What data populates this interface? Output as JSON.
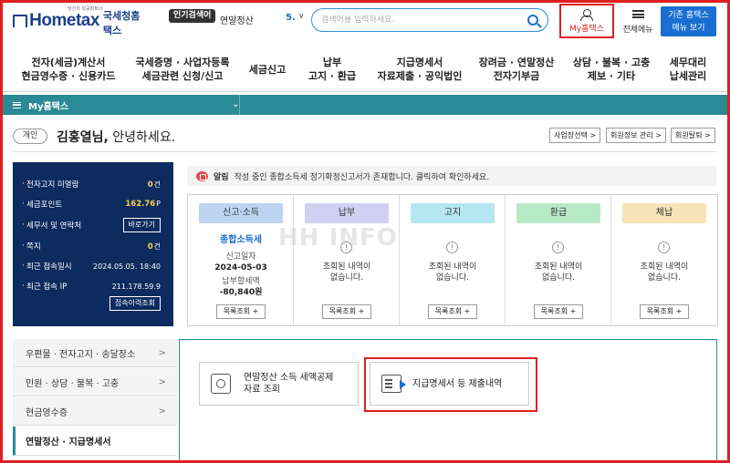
{
  "header": {
    "logo_text": "Hometax",
    "logo_sub": "국세청홈택스",
    "logo_tagline": "당신의 성공파트너",
    "popular_label": "인기검색어",
    "popular_value": "연말정산",
    "popular_rank": "5.",
    "search_placeholder": "검색어를 입력하세요.",
    "myhometax_label": "My홈택스",
    "allmenu_label": "전체메뉴",
    "oldhome_label": "기존 홈택스\n메뉴 보기"
  },
  "gnb": [
    {
      "label": "전자(세금)계산서\n현금영수증 · 신용카드"
    },
    {
      "label": "국세증명 · 사업자등록\n세금관련 신청/신고"
    },
    {
      "label": "세금신고"
    },
    {
      "label": "납부\n고지 · 환급"
    },
    {
      "label": "지급명세서\n자료제출 · 공익법인"
    },
    {
      "label": "장려금 · 연말정산\n전자기부금"
    },
    {
      "label": "상담 · 불복 · 고충\n제보 · 기타"
    },
    {
      "label": "세무대리\n납세관리"
    }
  ],
  "mybar": {
    "label": "My홈택스"
  },
  "user": {
    "badge": "개인",
    "name": "김홍열님,",
    "greeting": " 안녕하세요.",
    "btn_business": "사업장선택 >",
    "btn_member": "회원정보 관리 >",
    "btn_withdraw": "회원탈퇴 >"
  },
  "summary": {
    "rows": [
      {
        "label": "전자고지 미열람",
        "value": "0",
        "unit": "건"
      },
      {
        "label": "세금포인트",
        "value": "162.76",
        "unit": "P"
      },
      {
        "label": "세무서 및 연락처",
        "button": "바로가기"
      },
      {
        "label": "쪽지",
        "value": "0",
        "unit": "건"
      },
      {
        "label": "최근 접속일시",
        "value": "2024.05.05.  18:40"
      },
      {
        "label": "최근 접속 IP",
        "value": "211.178.59.9"
      }
    ],
    "history_button": "접속이력조회"
  },
  "notice": {
    "tag": "알림",
    "text": "작성 중인 종합소득세 정기확정신고서가 존재합니다. 클릭하여 확인하세요."
  },
  "status": [
    {
      "header": "신고·소득",
      "color": "#bcd4f2",
      "title": "종합소득세",
      "k1": "신고일자",
      "v1": "2024-05-03",
      "k2": "납부할세액",
      "v2": "-80,840원",
      "button": "목록조회 +"
    },
    {
      "header": "납부",
      "color": "#d2d0f2",
      "empty_text": "조회된 내역이\n없습니다.",
      "icon": "!",
      "button": "목록조회 +"
    },
    {
      "header": "고지",
      "color": "#b5e8f0",
      "empty_text": "조회된 내역이\n없습니다.",
      "icon": "!",
      "button": "목록조회 +"
    },
    {
      "header": "환급",
      "color": "#b9eac6",
      "empty_text": "조회된 내역이\n없습니다.",
      "icon": "!",
      "button": "목록조회 +"
    },
    {
      "header": "체납",
      "color": "#f7e4b8",
      "empty_text": "조회된 내역이\n없습니다.",
      "icon": "!",
      "button": "목록조회 +"
    }
  ],
  "left_menu": [
    {
      "label": "우편물 · 전자고지 · 송달장소",
      "chev": ">"
    },
    {
      "label": "민원 · 상담 · 불복 · 고충",
      "chev": ">"
    },
    {
      "label": "현금영수증",
      "chev": ">"
    },
    {
      "label": "연말정산 · 지급명세서",
      "chev": ""
    }
  ],
  "cards": [
    {
      "label": "연말정산 소득 세액공제\n자료 조회"
    },
    {
      "label": "지급명세서 등 제출내역"
    }
  ],
  "watermark": "HH INFO"
}
